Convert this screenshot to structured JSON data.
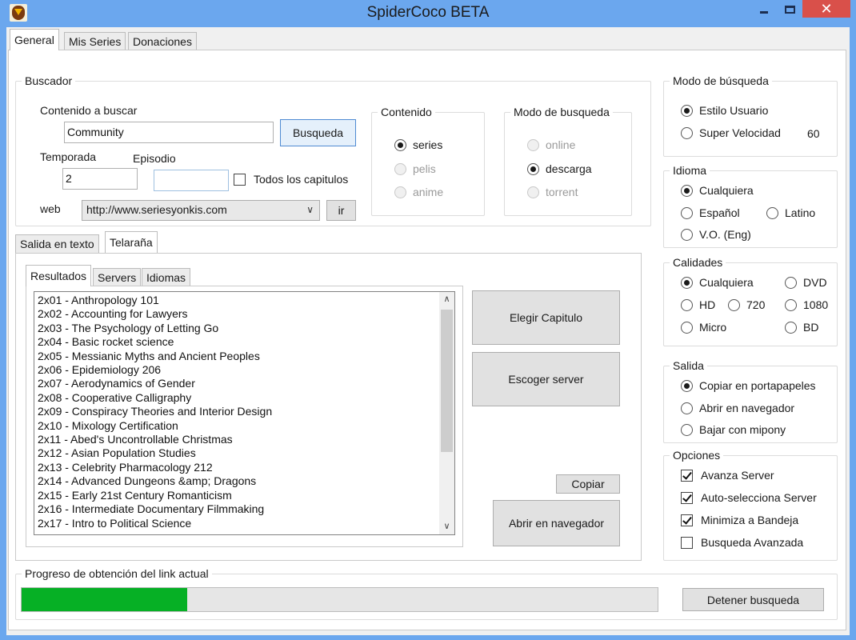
{
  "window": {
    "title": "SpiderCoco BETA",
    "close_glyph": "✕"
  },
  "main_tabs": [
    {
      "label": "General",
      "active": true
    },
    {
      "label": "Mis Series",
      "active": false
    },
    {
      "label": "Donaciones",
      "active": false
    }
  ],
  "buscador": {
    "legend": "Buscador",
    "contenido_label": "Contenido a buscar",
    "contenido_value": "Community",
    "search_button": "Busqueda",
    "temporada_label": "Temporada",
    "temporada_value": "2",
    "episodio_label": "Episodio",
    "episodio_value": "",
    "todos_label": "Todos los capitulos",
    "todos_checked": false,
    "web_label": "web",
    "web_value": "http://www.seriesyonkis.com",
    "go_button": "ir"
  },
  "contenido": {
    "legend": "Contenido",
    "options": [
      {
        "label": "series",
        "checked": true,
        "enabled": true
      },
      {
        "label": "pelis",
        "checked": false,
        "enabled": false
      },
      {
        "label": "anime",
        "checked": false,
        "enabled": false
      }
    ]
  },
  "modo_busqueda_inner": {
    "legend": "Modo de busqueda",
    "options": [
      {
        "label": "online",
        "checked": false,
        "enabled": false
      },
      {
        "label": "descarga",
        "checked": true,
        "enabled": true
      },
      {
        "label": "torrent",
        "checked": false,
        "enabled": false
      }
    ]
  },
  "inner_tabs": [
    {
      "label": "Salida en texto",
      "active": false
    },
    {
      "label": "Telaraña",
      "active": true
    }
  ],
  "result_tabs": [
    {
      "label": "Resultados",
      "active": true
    },
    {
      "label": "Servers",
      "active": false
    },
    {
      "label": "Idiomas",
      "active": false
    }
  ],
  "episodes": [
    "2x01 - Anthropology 101",
    "2x02 - Accounting for Lawyers",
    "2x03 - The Psychology of Letting Go",
    "2x04 - Basic rocket science",
    "2x05 - Messianic Myths and Ancient Peoples",
    "2x06 - Epidemiology 206",
    "2x07 - Aerodynamics of Gender",
    "2x08 - Cooperative Calligraphy",
    "2x09 - Conspiracy Theories and Interior Design",
    "2x10 - Mixology Certification",
    "2x11 - Abed's Uncontrollable Christmas",
    "2x12 - Asian Population Studies",
    "2x13 - Celebrity Pharmacology 212",
    "2x14 - Advanced Dungeons &amp; Dragons",
    "2x15 - Early 21st Century Romanticism",
    "2x16 - Intermediate Documentary Filmmaking",
    "2x17 - Intro to Political Science"
  ],
  "actions": {
    "elegir": "Elegir Capitulo",
    "escoger": "Escoger server",
    "copiar": "Copiar",
    "abrir": "Abrir en navegador"
  },
  "modo_busqueda": {
    "legend": "Modo de búsqueda",
    "options": [
      {
        "label": "Estilo Usuario",
        "checked": true
      },
      {
        "label": "Super Velocidad",
        "checked": false
      }
    ],
    "speed_value": "60"
  },
  "idioma": {
    "legend": "Idioma",
    "options": [
      {
        "label": "Cualquiera",
        "checked": true
      },
      {
        "label": "Español",
        "checked": false
      },
      {
        "label": "Latino",
        "checked": false
      },
      {
        "label": "V.O. (Eng)",
        "checked": false
      }
    ]
  },
  "calidades": {
    "legend": "Calidades",
    "options": [
      {
        "label": "Cualquiera",
        "checked": true
      },
      {
        "label": "DVD",
        "checked": false
      },
      {
        "label": "HD",
        "checked": false
      },
      {
        "label": "720",
        "checked": false
      },
      {
        "label": "1080",
        "checked": false
      },
      {
        "label": "Micro",
        "checked": false
      },
      {
        "label": "BD",
        "checked": false
      }
    ]
  },
  "salida": {
    "legend": "Salida",
    "options": [
      {
        "label": "Copiar en portapapeles",
        "checked": true
      },
      {
        "label": "Abrir en navegador",
        "checked": false
      },
      {
        "label": "Bajar con mipony",
        "checked": false
      }
    ]
  },
  "opciones": {
    "legend": "Opciones",
    "options": [
      {
        "label": "Avanza Server",
        "checked": true
      },
      {
        "label": "Auto-selecciona Server",
        "checked": true
      },
      {
        "label": "Minimiza a Bandeja",
        "checked": true
      },
      {
        "label": "Busqueda Avanzada",
        "checked": false
      }
    ]
  },
  "progreso": {
    "legend": "Progreso de obtención del link actual",
    "percent": 26,
    "color": "#06b025",
    "stop_button": "Detener busqueda"
  }
}
